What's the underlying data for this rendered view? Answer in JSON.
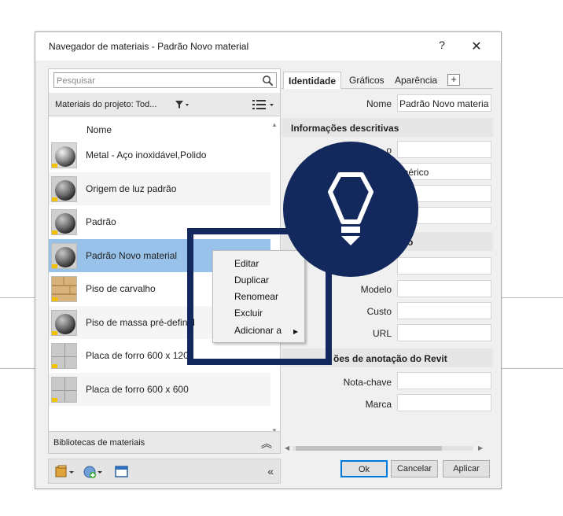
{
  "dialog": {
    "title": "Navegador de materiais - Padrão Novo material",
    "help": "?",
    "close": "✕"
  },
  "search": {
    "placeholder": "Pesquisar"
  },
  "project": {
    "label": "Materiais do projeto: Tod..."
  },
  "list": {
    "column_header": "Nome",
    "items": [
      {
        "label": "Metal - Aço inoxidável,Polido",
        "thumb": "sphere-metal",
        "state": "normal"
      },
      {
        "label": "Origem de luz padrão",
        "thumb": "sphere-gray",
        "state": "alt"
      },
      {
        "label": "Padrão",
        "thumb": "sphere-gray",
        "state": "normal"
      },
      {
        "label": "Padrão Novo material",
        "thumb": "sphere-gray",
        "state": "selected"
      },
      {
        "label": "Piso de carvalho",
        "thumb": "wood",
        "state": "normal"
      },
      {
        "label": "Piso de massa pré-definid",
        "thumb": "sphere-gray",
        "state": "alt"
      },
      {
        "label": "Placa de forro 600 x 1200",
        "thumb": "tile",
        "state": "normal"
      },
      {
        "label": "Placa de forro 600 x 600",
        "thumb": "tile",
        "state": "alt"
      }
    ]
  },
  "libraries": {
    "label": "Bibliotecas de materiais"
  },
  "tabs": {
    "identity": "Identidade",
    "graphics": "Gráficos",
    "appearance": "Aparência",
    "add": "+"
  },
  "identity": {
    "name_label": "Nome",
    "name_value": "Padrão Novo materia",
    "descriptive_header": "Informações descritivas",
    "desc_partial_label": "o",
    "class_partial_value": "enérico",
    "product_header_partial": "to",
    "model_label": "Modelo",
    "cost_label": "Custo",
    "url_label": "URL",
    "annotation_header_partial": "ões de anotação do Revit",
    "keynote_label": "Nota-chave",
    "mark_label": "Marca"
  },
  "buttons": {
    "ok": "Ok",
    "cancel": "Cancelar",
    "apply": "Aplicar"
  },
  "context_menu": {
    "items": [
      "Editar",
      "Duplicar",
      "Renomear",
      "Excluir",
      "Adicionar a"
    ],
    "submenu_arrow": "▶"
  },
  "colors": {
    "selection": "#99c2ea",
    "highlight_frame": "#13295d",
    "ok_border": "#0078d7"
  },
  "icons": [
    "search-icon",
    "filter-icon",
    "list-options-icon",
    "collapse-up-icon",
    "library-icon",
    "add-material-icon",
    "panel-icon",
    "collapse-left-icon",
    "lightbulb-icon"
  ]
}
